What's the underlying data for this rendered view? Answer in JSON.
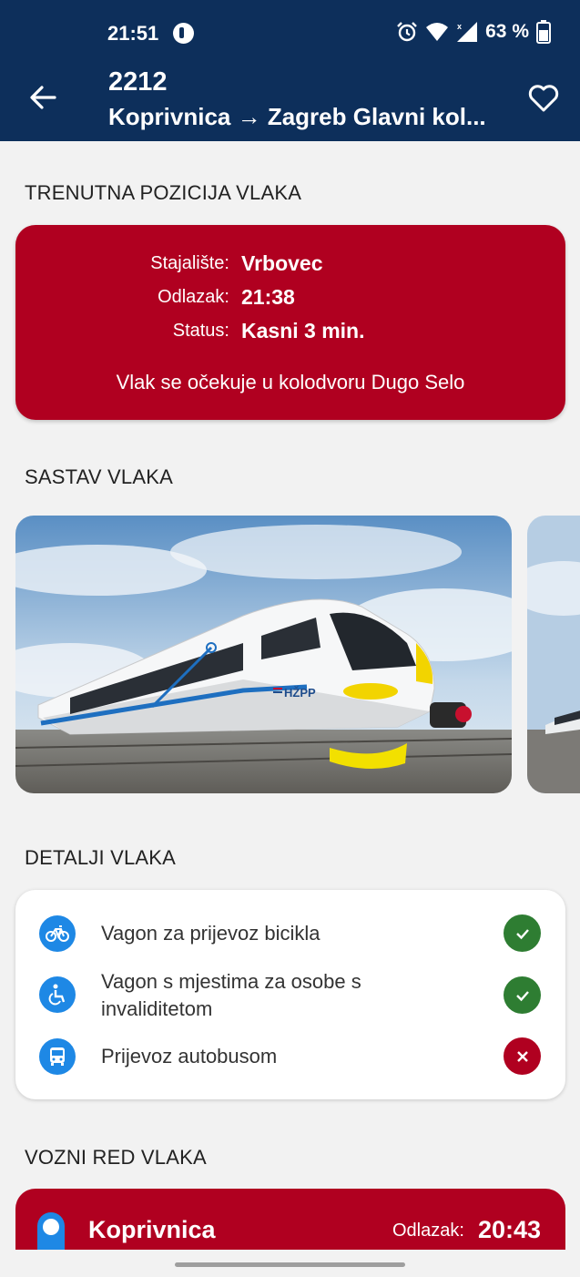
{
  "status_bar": {
    "time": "21:51",
    "battery": "63 %",
    "icons": [
      "app-notification-icon",
      "alarm-icon",
      "wifi-icon",
      "signal-icon",
      "battery-icon"
    ]
  },
  "app_bar": {
    "train_number": "2212",
    "route": "Koprivnica → Zagreb Glavni kol...",
    "icons": [
      "back-arrow-icon",
      "heart-icon"
    ]
  },
  "position": {
    "section_title": "TRENUTNA POZICIJA VLAKA",
    "stop_label": "Stajalište:",
    "stop_value": "Vrbovec",
    "departure_label": "Odlazak:",
    "departure_value": "21:38",
    "status_label": "Status:",
    "status_value": "Kasni 3 min.",
    "note": "Vlak se očekuje u kolodvoru Dugo Selo",
    "card_color": "#b00020"
  },
  "composition": {
    "section_title": "SASTAV VLAKA",
    "train_livery_text": "HŽPP"
  },
  "details": {
    "section_title": "DETALJI VLAKA",
    "items": [
      {
        "label": "Vagon za prijevoz bicikla",
        "icon": "bicycle-icon",
        "available": true
      },
      {
        "label": "Vagon s mjestima za osobe s invaliditetom",
        "icon": "wheelchair-icon",
        "available": true
      },
      {
        "label": "Prijevoz autobusom",
        "icon": "bus-icon",
        "available": false
      }
    ],
    "colors": {
      "icon_bg": "#1e88e5",
      "ok": "#2e7d32",
      "no": "#b00020"
    }
  },
  "timetable": {
    "section_title": "VOZNI RED VLAKA",
    "first_stop": {
      "station": "Koprivnica",
      "departure_label": "Odlazak:",
      "departure_value": "20:43"
    }
  },
  "theme": {
    "primary": "#0d2f5b",
    "accent": "#b00020",
    "background": "#f2f2f2"
  }
}
